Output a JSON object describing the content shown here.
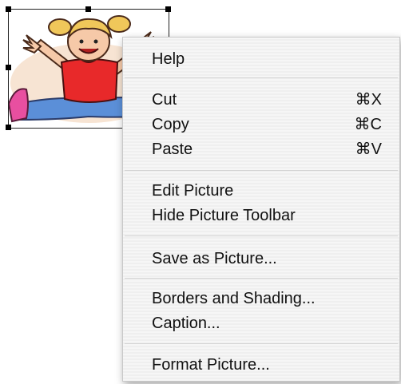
{
  "context_menu": {
    "help": "Help",
    "cut": "Cut",
    "cut_shortcut": "⌘X",
    "copy": "Copy",
    "copy_shortcut": "⌘C",
    "paste": "Paste",
    "paste_shortcut": "⌘V",
    "edit_picture": "Edit Picture",
    "hide_picture_toolbar": "Hide Picture Toolbar",
    "save_as_picture": "Save as Picture...",
    "borders_and_shading": "Borders and Shading...",
    "caption": "Caption...",
    "format_picture": "Format Picture..."
  },
  "picture": {
    "subject": "clipart-girl-doing-splits",
    "colors": {
      "shirt": "#e8292a",
      "pants": "#5b8fd8",
      "hair": "#f0c75a",
      "skin": "#f6c9a8",
      "shoe": "#e84fa0",
      "halo": "#f3d9c0"
    }
  }
}
